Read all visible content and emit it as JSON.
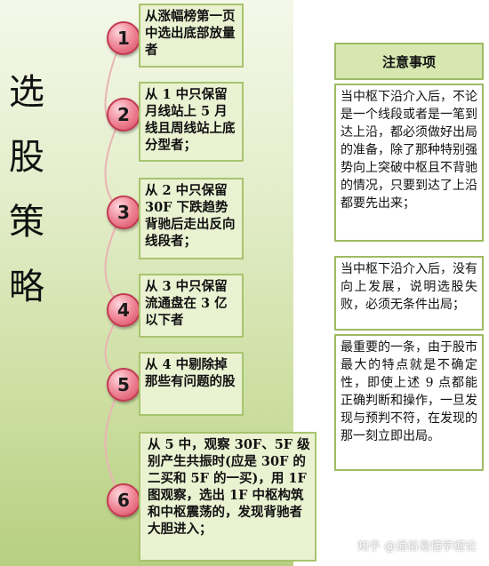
{
  "title_chars": [
    "选",
    "股",
    "策",
    "略"
  ],
  "steps": [
    {
      "num": "1",
      "text": "从涨幅榜第一页中选出底部放量者"
    },
    {
      "num": "2",
      "text": "从 1 中只保留月线站上 5 月线且周线站上底分型者；"
    },
    {
      "num": "3",
      "text": "从 2 中只保留 30F 下跌趋势背驰后走出反向线段者；"
    },
    {
      "num": "4",
      "text": "从 3 中只保留流通盘在 3 亿以下者"
    },
    {
      "num": "5",
      "text": "从 4 中剔除掉那些有问题的股"
    },
    {
      "num": "6",
      "text": "从 5 中，观察 30F、5F 级别产生共振时(应是 30F 的二买和 5F 的一买)，用 1F 图观察，选出 1F 中枢构筑和中枢震荡的，发现背驰者大胆进入；"
    }
  ],
  "notes": {
    "header": "注意事项",
    "items": [
      "当中枢下沿介入后，不论是一个线段或者是一笔到达上沿，都必须做好出局的准备，除了那种特别强势向上突破中枢且不背驰的情况，只要到达了上沿都要先出来；",
      "当中枢下沿介入后，没有向上发展，说明选股失败，必须无条件出局；",
      "最重要的一条，由于股市最大的特点就是不确定性，即使上述 9 点都能正确判断和操作，一旦发现与预判不符，在发现的那一刻立即出局。"
    ]
  },
  "watermark": "知乎 @通俗易懂学缠论",
  "colors": {
    "panel_bg": "#d6e5b4",
    "box_border": "#a8c46e",
    "circle_fill": "#e8667c"
  }
}
